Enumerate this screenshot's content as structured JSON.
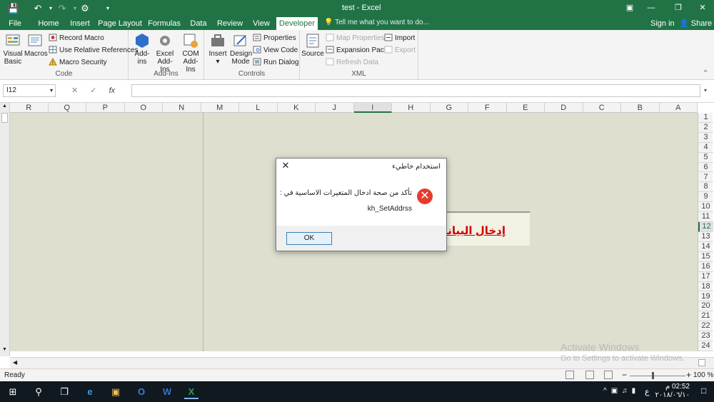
{
  "window": {
    "title": "test - Excel",
    "tell_me": "Tell me what you want to do...",
    "sign_in": "Sign in",
    "share": "Share"
  },
  "tabs": [
    {
      "label": "File"
    },
    {
      "label": "Home"
    },
    {
      "label": "Insert"
    },
    {
      "label": "Page Layout"
    },
    {
      "label": "Formulas"
    },
    {
      "label": "Data"
    },
    {
      "label": "Review"
    },
    {
      "label": "View"
    },
    {
      "label": "Developer"
    }
  ],
  "active_tab": "Developer",
  "ribbon": {
    "code": {
      "title": "Code",
      "visual_basic": "Visual Basic",
      "macros": "Macros",
      "record_macro": "Record Macro",
      "relative_refs": "Use Relative References",
      "macro_security": "Macro Security"
    },
    "addins": {
      "title": "Add-Ins",
      "addins": "Add-ins",
      "excel_addins": "Excel Add-Ins",
      "com_addins": "COM Add-Ins"
    },
    "controls": {
      "title": "Controls",
      "insert": "Insert",
      "design_mode": "Design Mode",
      "properties": "Properties",
      "view_code": "View Code",
      "run_dialog": "Run Dialog"
    },
    "xml": {
      "title": "XML",
      "source": "Source",
      "map_properties": "Map Properties",
      "expansion_packs": "Expansion Packs",
      "refresh_data": "Refresh Data",
      "import": "Import",
      "export": "Export"
    }
  },
  "formula_bar": {
    "name_box": "I12",
    "formula": ""
  },
  "columns": [
    "R",
    "Q",
    "P",
    "O",
    "N",
    "M",
    "L",
    "K",
    "J",
    "I",
    "H",
    "G",
    "F",
    "E",
    "D",
    "C",
    "B",
    "A"
  ],
  "selected_column": "I",
  "rows": [
    "1",
    "2",
    "3",
    "4",
    "5",
    "6",
    "7",
    "8",
    "9",
    "10",
    "11",
    "12",
    "13",
    "14",
    "15",
    "16",
    "17",
    "18",
    "19",
    "20",
    "21",
    "22",
    "23",
    "24"
  ],
  "selected_row": "12",
  "shape_label": "إدخال البيانا",
  "dialog": {
    "title": "استخدام خاطيء",
    "message": "تأكد من صحة ادخال المتغيرات الاساسية في :",
    "detail": "kh_SetAddrss",
    "ok_label": "OK"
  },
  "status": {
    "ready": "Ready",
    "zoom": "100 %"
  },
  "watermark": {
    "line1": "Activate Windows",
    "line2": "Go to Settings to activate Windows."
  },
  "taskbar": {
    "time": "02:52 م",
    "date": "٢٠١٨/٠٦/١٠",
    "lang": "ع"
  },
  "colors": {
    "excel_green": "#217346",
    "sheet_bg": "#dfdfcf",
    "error_red": "#e53c2e",
    "shape_text": "#d40000"
  }
}
